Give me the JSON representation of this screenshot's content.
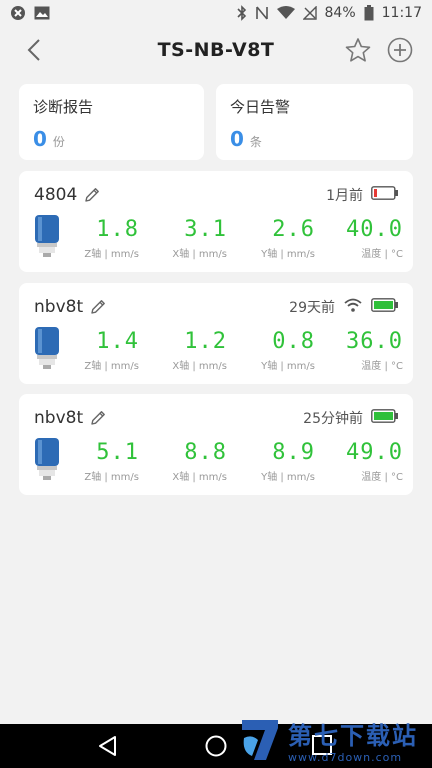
{
  "status_bar": {
    "battery_percent": "84%",
    "time": "11:17",
    "icons": [
      "close-circle-icon",
      "image-icon",
      "bluetooth-icon",
      "nfc-icon",
      "wifi-icon",
      "no-signal-icon",
      "battery-icon"
    ]
  },
  "header": {
    "title": "TS-NB-V8T",
    "icons": [
      "back-icon",
      "star-icon",
      "add-circle-icon"
    ]
  },
  "summary": {
    "report": {
      "label": "诊断报告",
      "value": "0",
      "unit": "份"
    },
    "alarm": {
      "label": "今日告警",
      "value": "0",
      "unit": "条"
    }
  },
  "devices": [
    {
      "name": "4804",
      "time": "1月前",
      "signal": "none",
      "battery": "low",
      "readings": [
        {
          "value": "1.8",
          "label": "Z轴 | mm/s"
        },
        {
          "value": "3.1",
          "label": "X轴 | mm/s"
        },
        {
          "value": "2.6",
          "label": "Y轴 | mm/s"
        },
        {
          "value": "40.0",
          "label": "温度 | °C"
        }
      ]
    },
    {
      "name": "nbv8t",
      "time": "29天前",
      "signal": "wifi",
      "battery": "full",
      "readings": [
        {
          "value": "1.4",
          "label": "Z轴 | mm/s"
        },
        {
          "value": "1.2",
          "label": "X轴 | mm/s"
        },
        {
          "value": "0.8",
          "label": "Y轴 | mm/s"
        },
        {
          "value": "36.0",
          "label": "温度 | °C"
        }
      ]
    },
    {
      "name": "nbv8t",
      "time": "25分钟前",
      "signal": "none",
      "battery": "full",
      "readings": [
        {
          "value": "5.1",
          "label": "Z轴 | mm/s"
        },
        {
          "value": "8.8",
          "label": "X轴 | mm/s"
        },
        {
          "value": "8.9",
          "label": "Y轴 | mm/s"
        },
        {
          "value": "49.0",
          "label": "温度 | °C"
        }
      ]
    }
  ],
  "colors": {
    "accent_blue": "#3a8ee6",
    "reading_green": "#30c23a",
    "battery_low": "#e53935",
    "battery_full": "#2fbf3a"
  },
  "watermark": {
    "title": "第七下载站",
    "url": "www.d7down.com"
  }
}
